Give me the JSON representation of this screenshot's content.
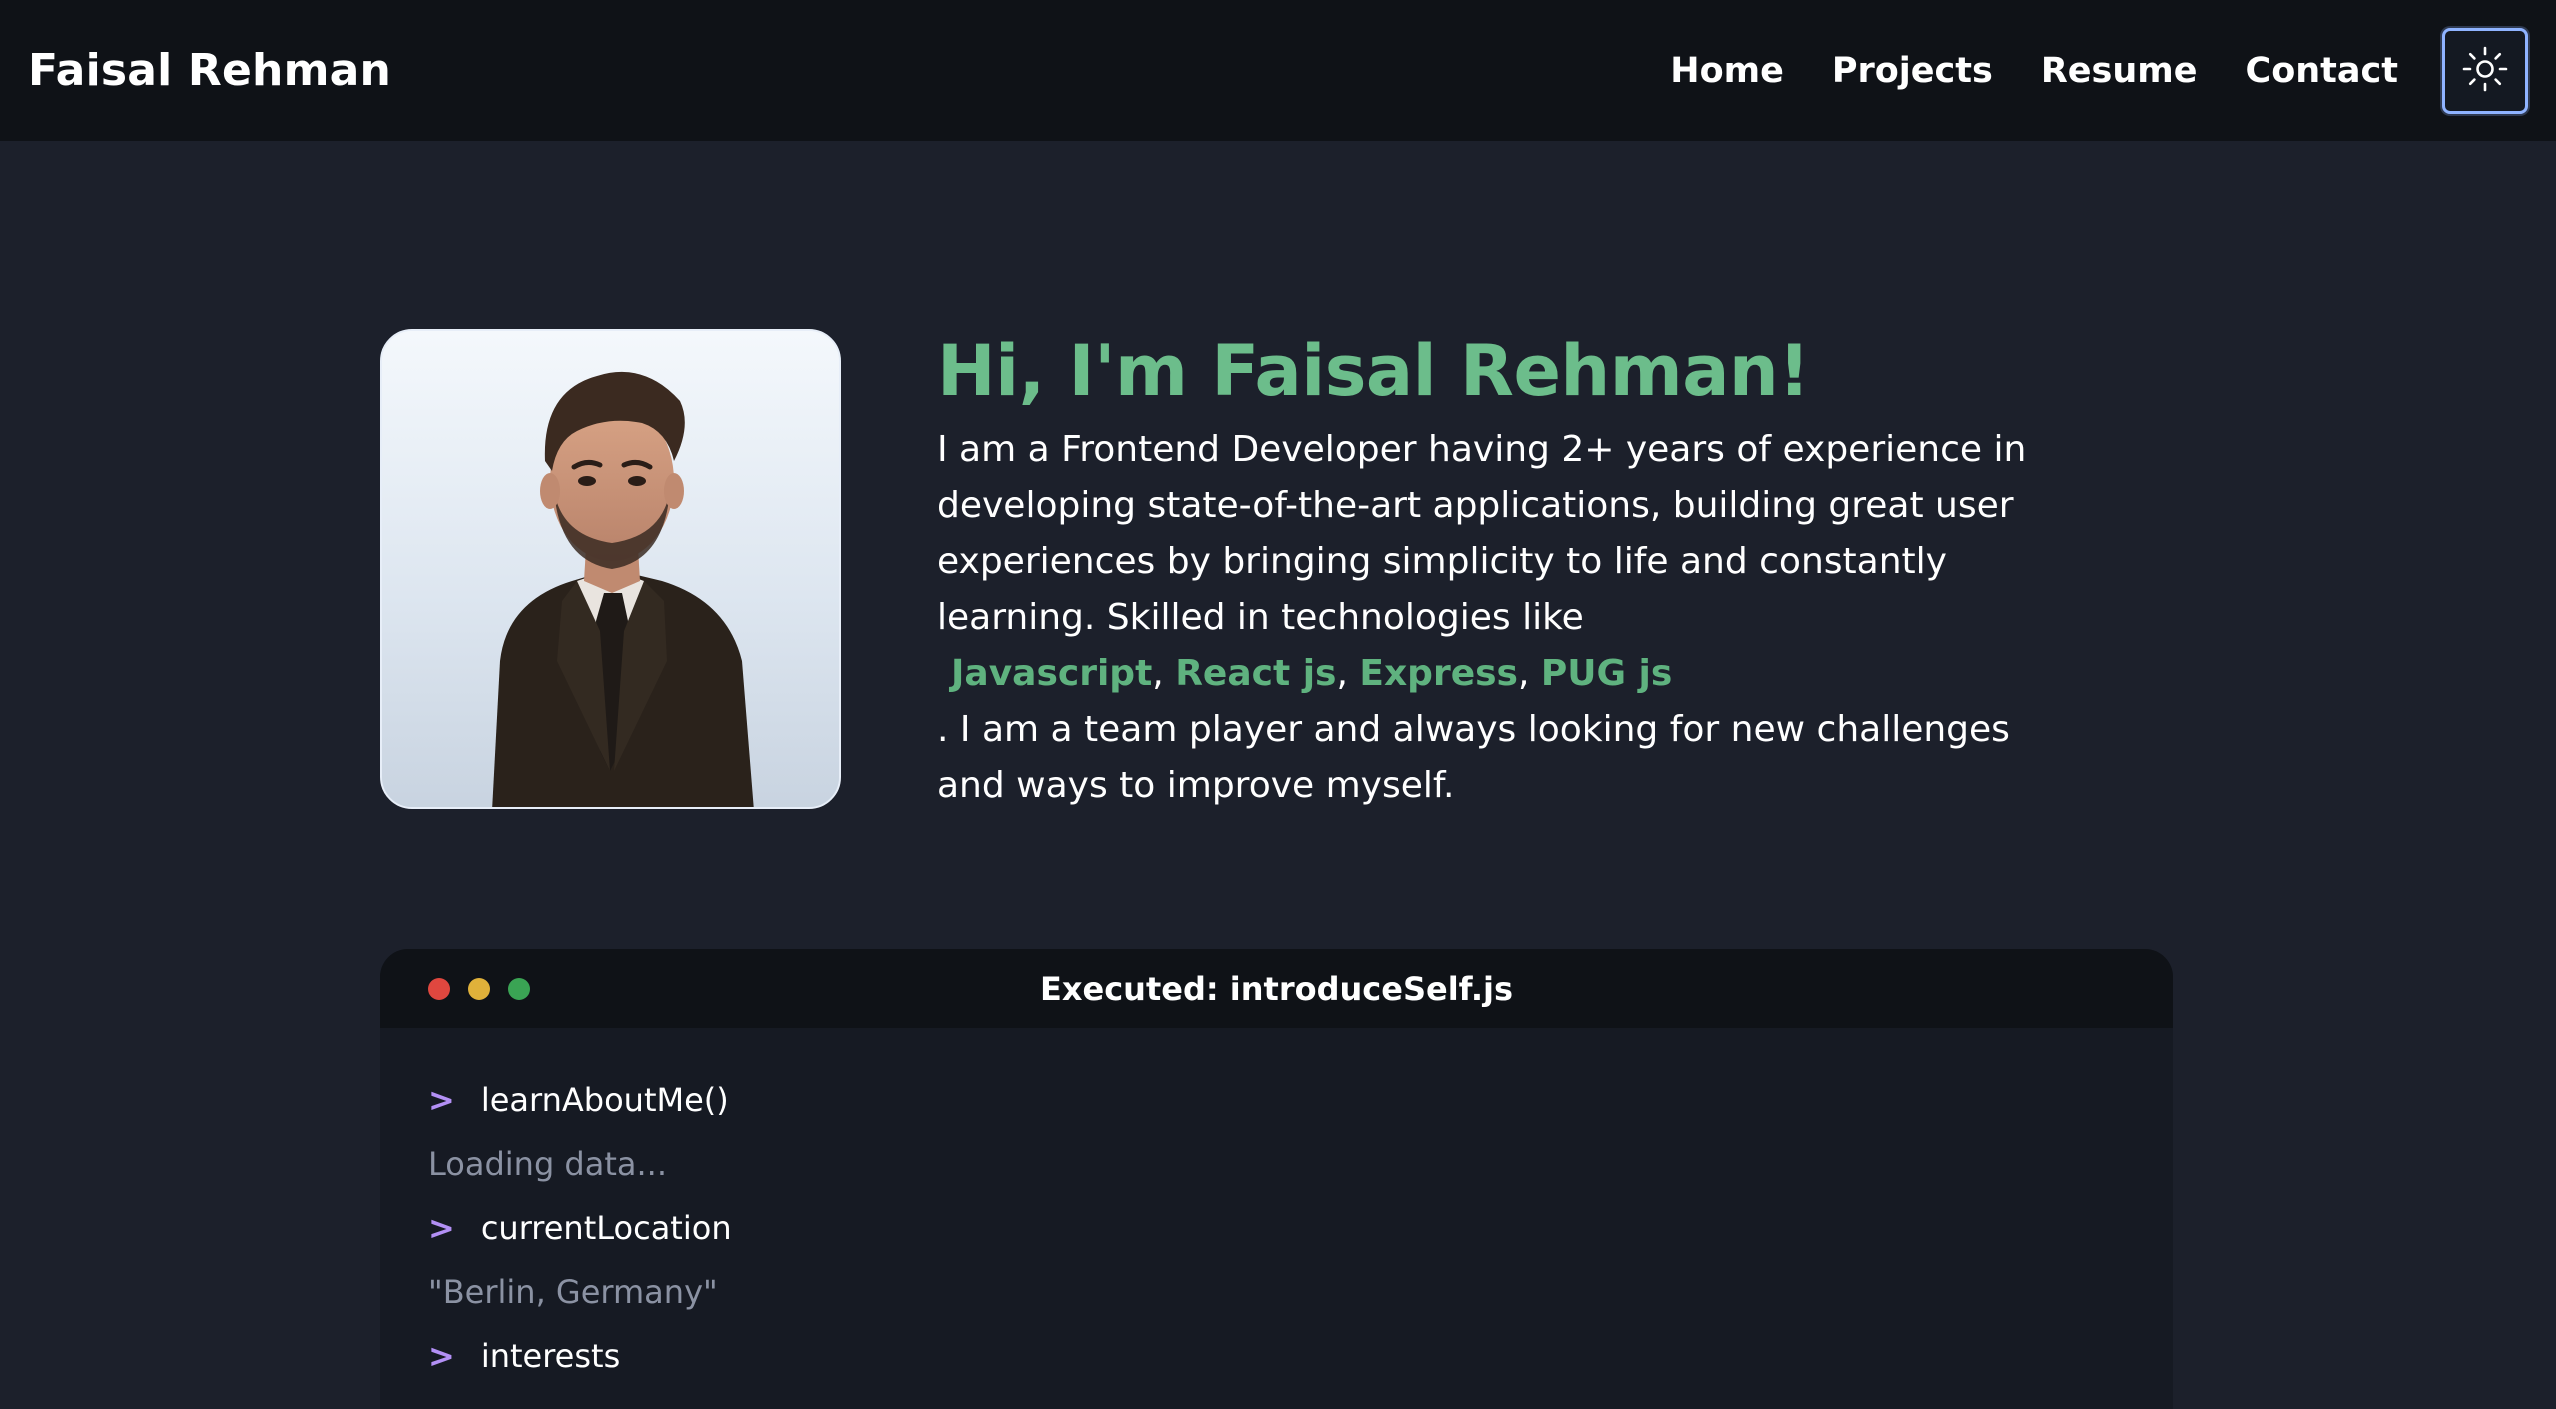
{
  "header": {
    "brand": "Faisal Rehman",
    "nav": [
      "Home",
      "Projects",
      "Resume",
      "Contact"
    ],
    "theme_toggle_icon": "sun-icon"
  },
  "hero": {
    "title": "Hi, I'm Faisal Rehman!",
    "intro": "I am a Frontend Developer having 2+ years of experience in developing state-of-the-art applications, building great user experiences by bringing simplicity to life and constantly learning. Skilled in technologies like",
    "skills": [
      "Javascript",
      "React js",
      "Express",
      "PUG js"
    ],
    "outro": ".  I am a team player and always looking for new challenges and ways to improve myself."
  },
  "terminal": {
    "title": "Executed: introduceSelf.js",
    "lines": [
      {
        "type": "command",
        "prompt": ">",
        "text": "learnAboutMe()"
      },
      {
        "type": "output",
        "text": "Loading data..."
      },
      {
        "type": "command",
        "prompt": ">",
        "text": "currentLocation"
      },
      {
        "type": "output",
        "text": "\"Berlin, Germany\""
      },
      {
        "type": "command",
        "prompt": ">",
        "text": "interests"
      }
    ]
  },
  "colors": {
    "accent_green": "#6cbd8b",
    "skill_green": "#5fb27f",
    "prompt_purple": "#b390f5",
    "dot_red": "#e0473f",
    "dot_yellow": "#e0b13a",
    "dot_green": "#3aa454",
    "page_bg": "#1c202b",
    "header_bg": "#0f1217"
  }
}
